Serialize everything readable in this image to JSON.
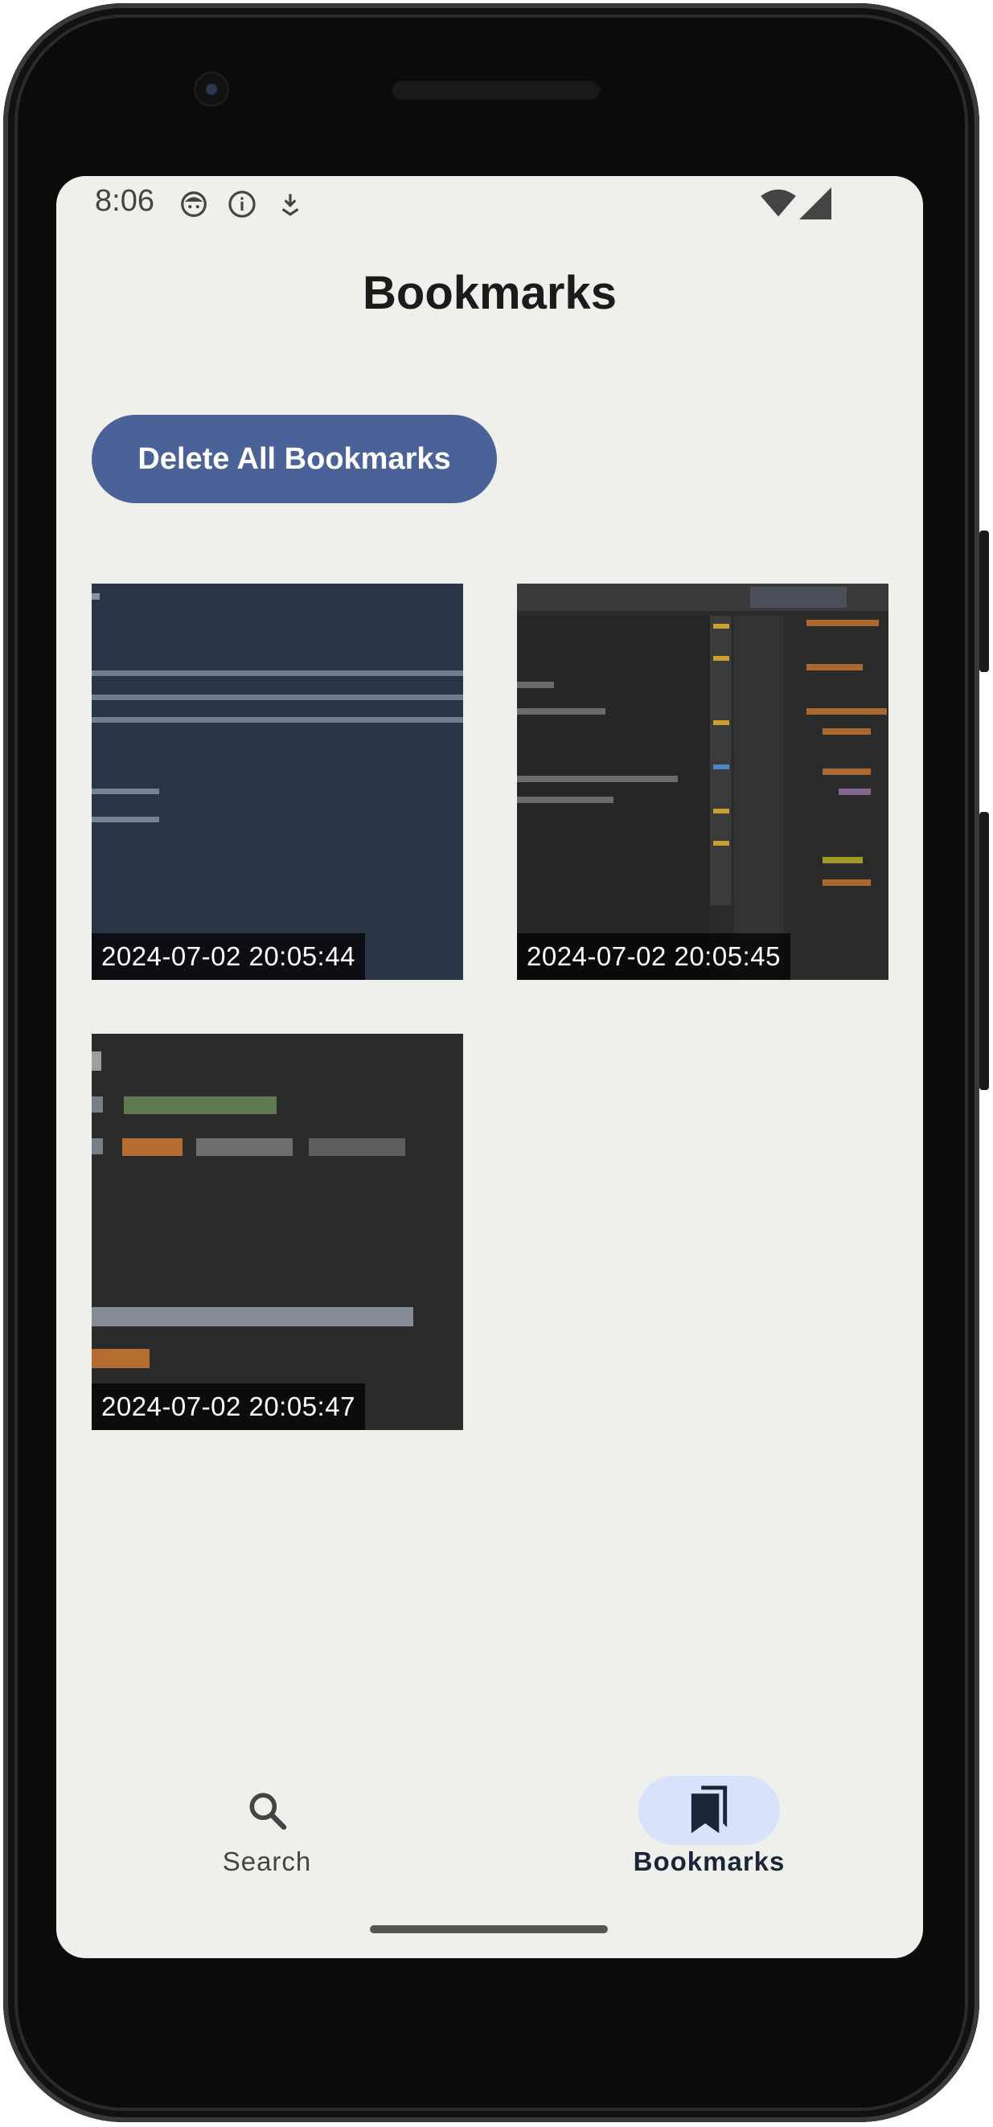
{
  "status_bar": {
    "time": "8:06",
    "icons": [
      "face-icon",
      "info-icon",
      "download-icon"
    ],
    "right_icons": [
      "wifi-icon",
      "signal-icon"
    ]
  },
  "header": {
    "title": "Bookmarks"
  },
  "actions": {
    "delete_all_label": "Delete All Bookmarks"
  },
  "bookmarks": [
    {
      "timestamp": "2024-07-02 20:05:44",
      "thumbnail": "dark-blue code-editor screenshot with korean text"
    },
    {
      "timestamp": "2024-07-02 20:05:45",
      "thumbnail": "IDE screenshot with java file"
    },
    {
      "timestamp": "2024-07-02 20:05:47",
      "thumbnail": "kotlin code screenshot"
    }
  ],
  "bottom_nav": {
    "items": [
      {
        "label": "Search",
        "icon": "search-icon",
        "selected": false
      },
      {
        "label": "Bookmarks",
        "icon": "bookmark-icon",
        "selected": true
      }
    ]
  },
  "colors": {
    "screen_bg": "#efefeb",
    "accent_button": "#4b6298",
    "nav_selected_pill": "#d9e2fb",
    "nav_selected_text": "#1c2538"
  }
}
